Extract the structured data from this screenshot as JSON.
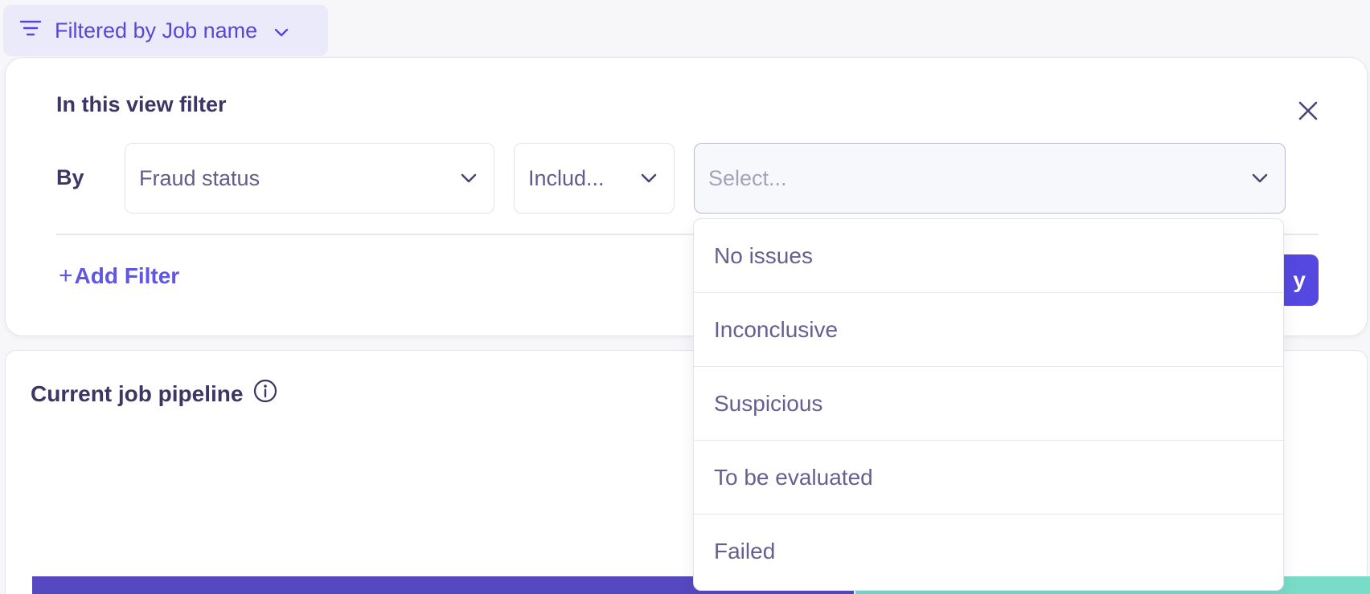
{
  "filter_chip": {
    "label": "Filtered by Job name",
    "icon": "filter-lines-icon"
  },
  "popover": {
    "title": "In this view filter",
    "by_label": "By",
    "field_select": {
      "value": "Fraud status"
    },
    "operator_select": {
      "value": "Includ..."
    },
    "value_select": {
      "placeholder": "Select..."
    },
    "add_filter_label": "Add Filter",
    "add_filter_plus": "+",
    "apply_label": "y"
  },
  "dropdown": {
    "options": [
      {
        "label": "No issues"
      },
      {
        "label": "Inconclusive"
      },
      {
        "label": "Suspicious"
      },
      {
        "label": "To be evaluated"
      },
      {
        "label": "Failed"
      }
    ]
  },
  "card": {
    "title": "Current job pipeline",
    "info_icon": "info-circle-icon"
  },
  "colors": {
    "accent": "#5847d6",
    "primary_button": "#5448e0",
    "pipeline_primary": "#5548c0",
    "pipeline_secondary": "#79dcc9",
    "text_dark": "#3b3664"
  }
}
